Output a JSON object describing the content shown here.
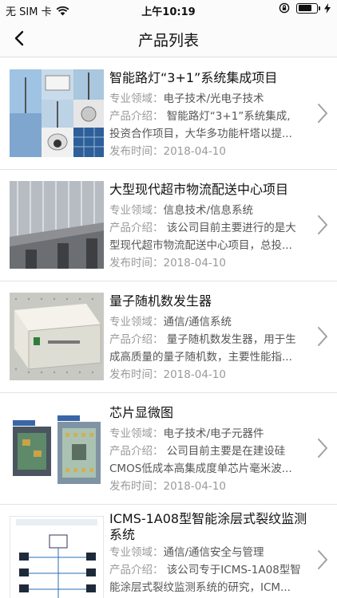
{
  "status_bar": {
    "carrier": "无 SIM 卡",
    "time": "上午10:19",
    "battery_level": 0.75
  },
  "nav": {
    "title": "产品列表",
    "back_icon": "chevron-left-icon"
  },
  "labels": {
    "field": "专业领域：",
    "intro": "产品介绍：",
    "date": "发布时间："
  },
  "items": [
    {
      "title": "智能路灯“3+1”系统集成项目",
      "field": "电子技术/光电子技术",
      "intro_line1": "智能路灯“3+1”系统集成,",
      "intro_line2": "投资合作项目，大华多功能杆塔以提...",
      "date": "2018-04-10"
    },
    {
      "title": "大型现代超市物流配送中心项目",
      "field": "信息技术/信息系统",
      "intro_line1": "该公司目前主要进行的是大",
      "intro_line2": "型现代超市物流配送中心项目，总投...",
      "date": "2018-04-10"
    },
    {
      "title": "量子随机数发生器",
      "field": "通信/通信系统",
      "intro_line1": "量子随机数发生器，用于生",
      "intro_line2": "成高质量的量子随机数，主要性能指...",
      "date": "2018-04-10"
    },
    {
      "title": "芯片显微图",
      "field": "电子技术/电子元器件",
      "intro_line1": "公司目前主要是在建设硅",
      "intro_line2": "CMOS低成本高集成度单芯片毫米波...",
      "date": "2018-04-10"
    },
    {
      "title": "ICMS-1A08型智能涂层式裂纹监测系统",
      "field": "通信/通信安全与管理",
      "intro_line1": "该公司专于ICMS-1A08型智",
      "intro_line2": "能涂层式裂纹监测系统的研究，ICM..."
    }
  ]
}
